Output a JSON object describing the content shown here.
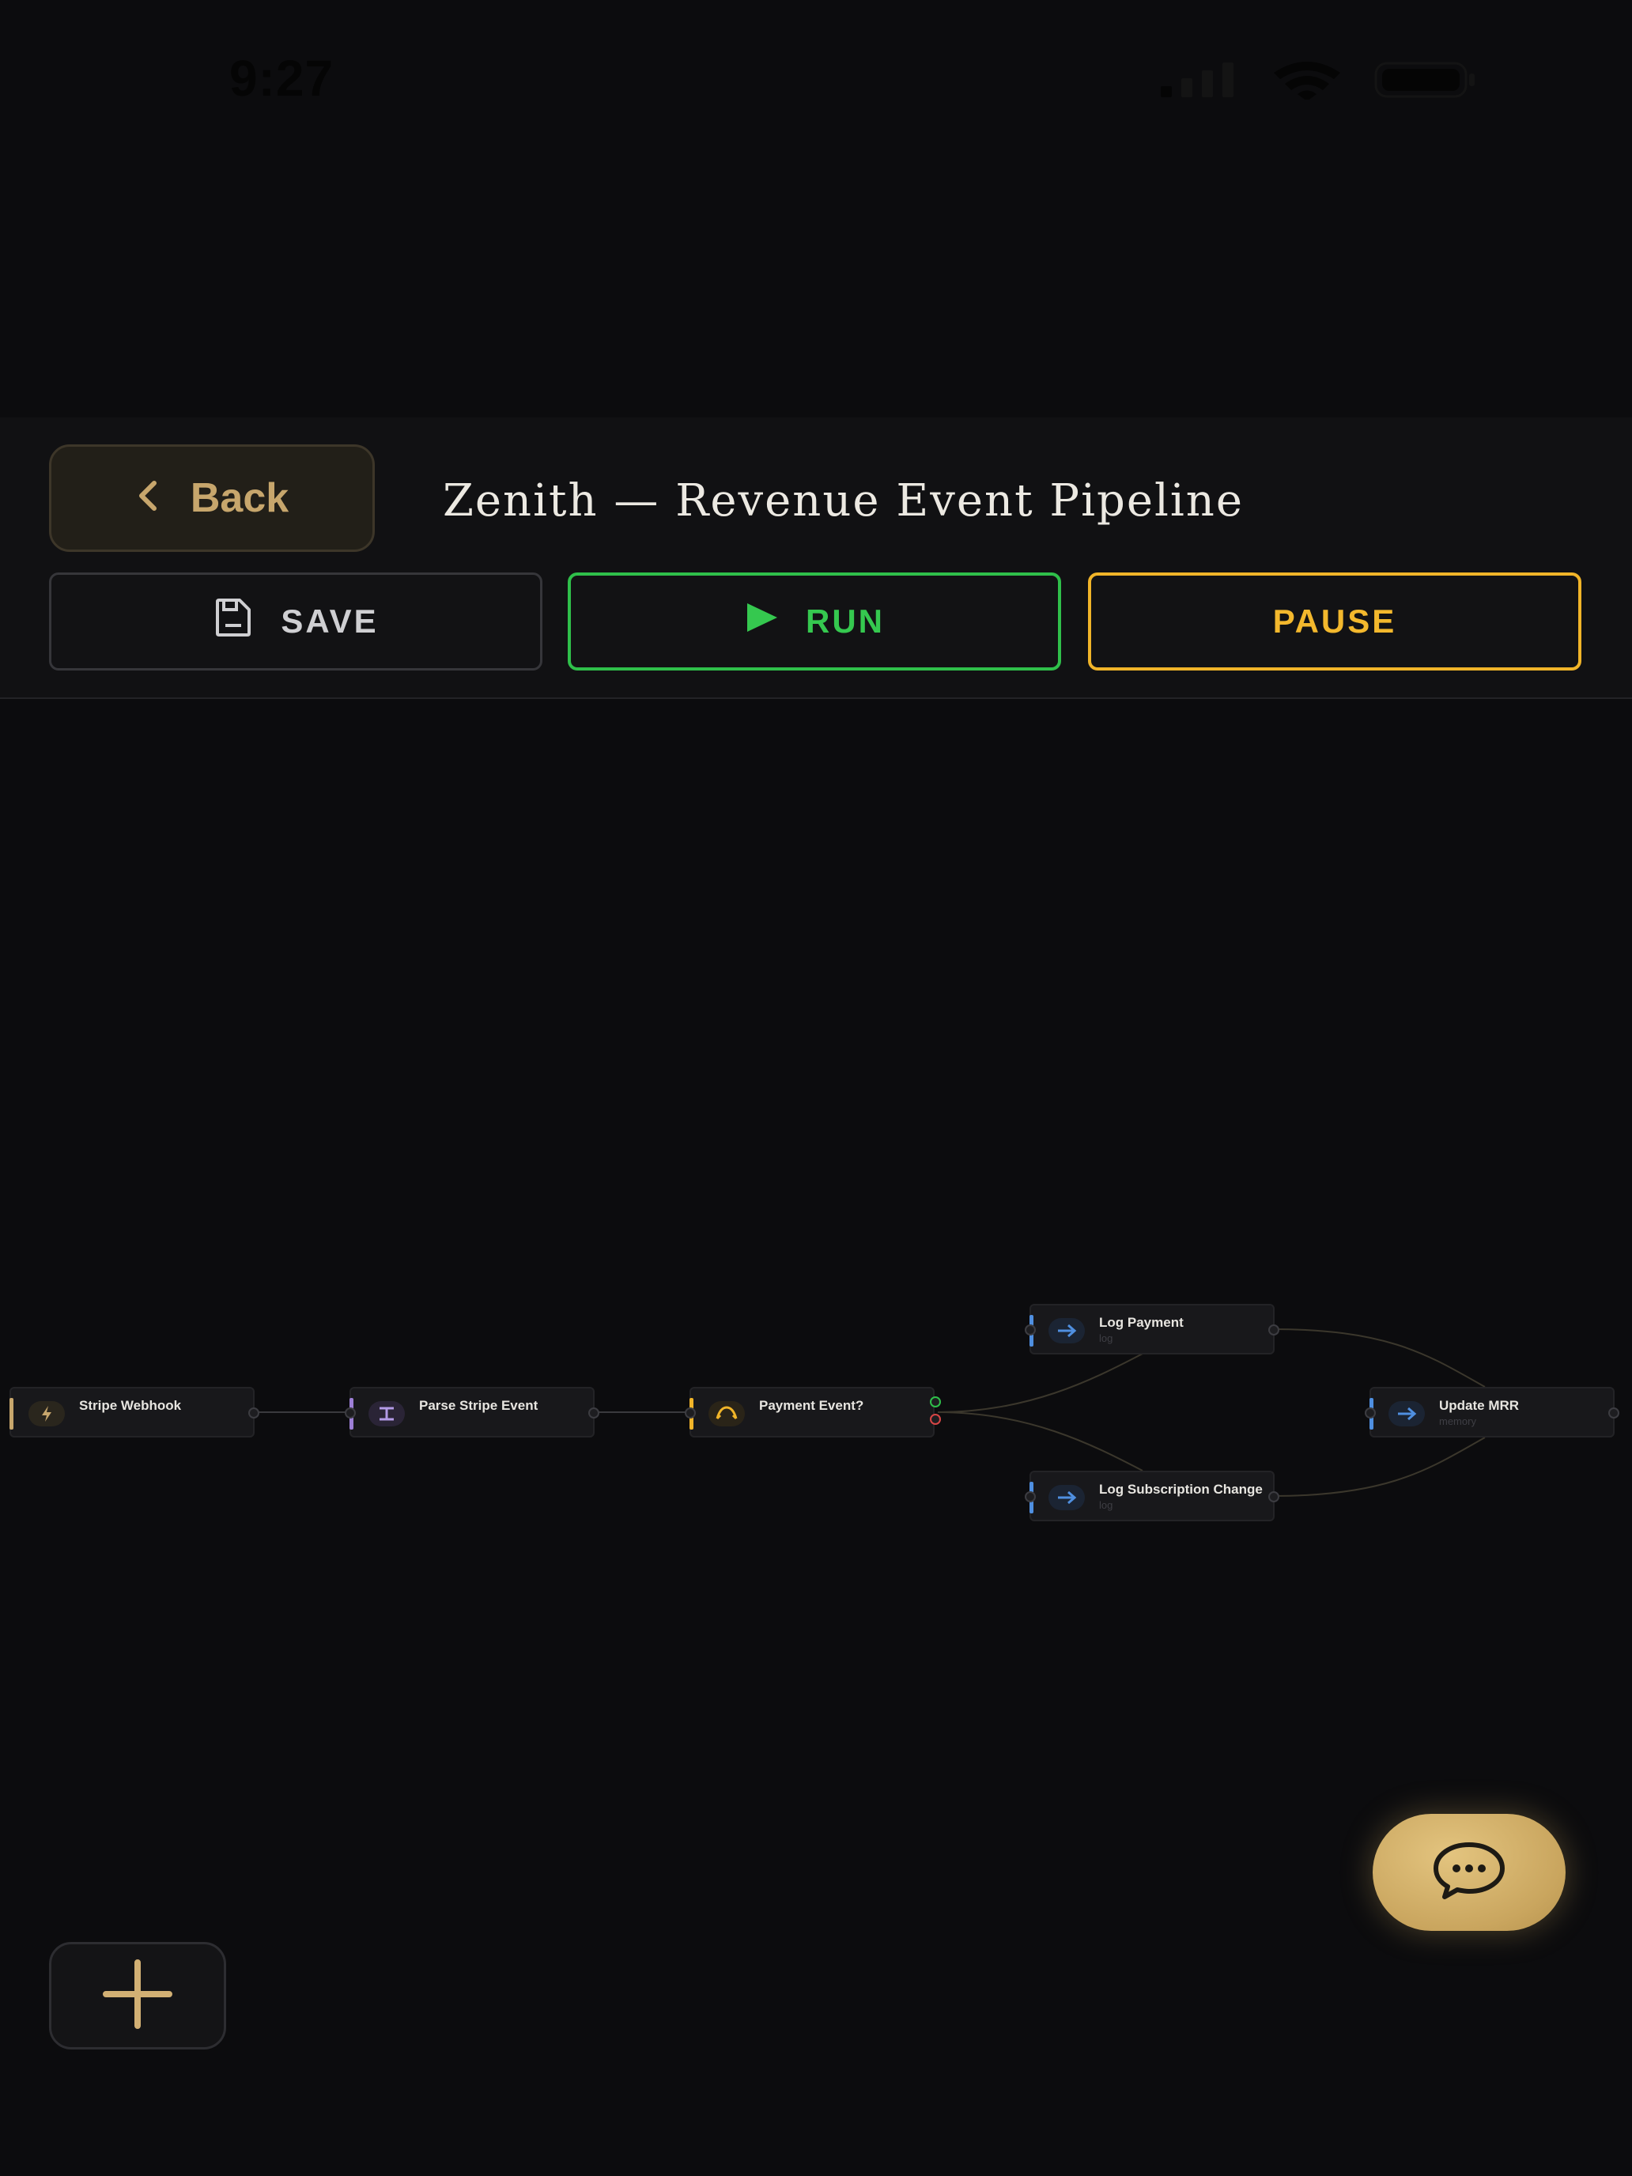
{
  "status_bar": {
    "time": "9:27",
    "icons": [
      "cellular-signal-icon",
      "wifi-icon",
      "battery-icon"
    ]
  },
  "header": {
    "back_label": "Back",
    "title": "Zenith — Revenue Event Pipeline",
    "save_label": "SAVE",
    "run_label": "RUN",
    "pause_label": "PAUSE"
  },
  "nodes": {
    "stripe_webhook": {
      "label": "Stripe Webhook",
      "color": "#c7a66c",
      "icon": "lightning-icon"
    },
    "parse_stripe_event": {
      "label": "Parse Stripe Event",
      "color": "#9d7fd6",
      "icon": "parse-icon"
    },
    "payment_event": {
      "label": "Payment Event?",
      "color": "#f0b429",
      "icon": "branch-icon"
    },
    "log_payment": {
      "label": "Log Payment",
      "sub": "log",
      "color": "#4f8fe0",
      "icon": "arrow-right-icon"
    },
    "log_subscription_change": {
      "label": "Log Subscription Change",
      "sub": "log",
      "color": "#4f8fe0",
      "icon": "arrow-right-icon"
    },
    "update_mrr": {
      "label": "Update MRR",
      "sub": "memory",
      "color": "#4f8fe0",
      "icon": "arrow-right-icon"
    }
  },
  "colors": {
    "accent": "#c9a55e",
    "run": "#35c84f",
    "pause": "#f3b82d",
    "true_port": "#2fbf4a",
    "false_port": "#d64545"
  },
  "fabs": {
    "chat_icon": "chat-bubble-icon",
    "add_icon": "plus-icon"
  }
}
